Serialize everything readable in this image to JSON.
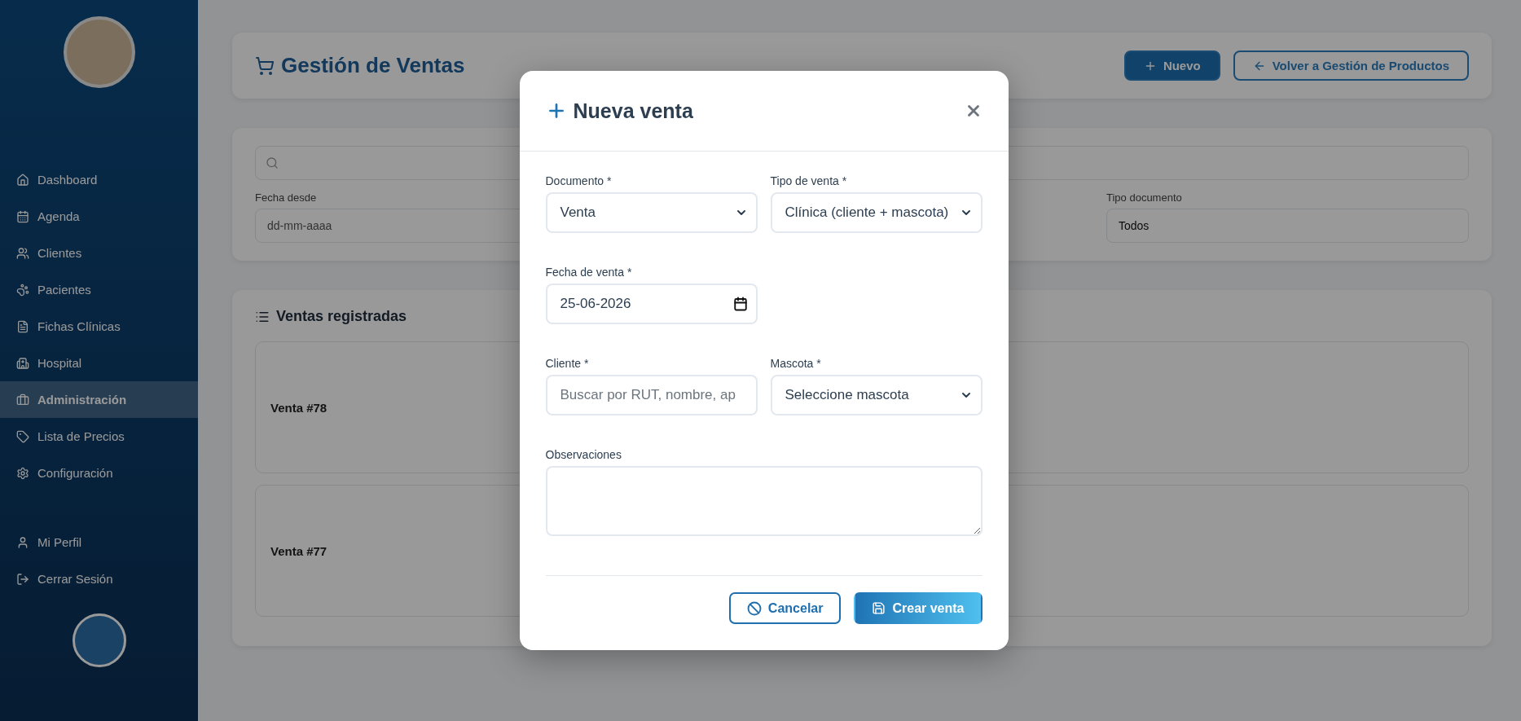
{
  "sidebar": {
    "items": [
      {
        "label": "Dashboard",
        "selected": false
      },
      {
        "label": "Agenda",
        "selected": false
      },
      {
        "label": "Clientes",
        "selected": false
      },
      {
        "label": "Pacientes",
        "selected": false
      },
      {
        "label": "Fichas Clínicas",
        "selected": false
      },
      {
        "label": "Hospital",
        "selected": false
      },
      {
        "label": "Administración",
        "selected": true
      },
      {
        "label": "Lista de Precios",
        "selected": false
      },
      {
        "label": "Configuración",
        "selected": false
      }
    ],
    "footer_items": [
      {
        "label": "Mi Perfil"
      },
      {
        "label": "Cerrar Sesión"
      }
    ]
  },
  "header": {
    "title": "Gestión de Ventas",
    "buttons": [
      {
        "label": "Nuevo",
        "kind": "primary"
      },
      {
        "label": "Volver a Gestión de Productos",
        "kind": "outline"
      }
    ]
  },
  "filters": {
    "fields": [
      {
        "label": "Fecha desde",
        "placeholder": "dd-mm-aaaa"
      },
      {
        "label": "Tipo documento",
        "value": "Todos"
      }
    ]
  },
  "sales": {
    "title": "Ventas registradas",
    "items": [
      {
        "title": "Venta #78"
      },
      {
        "title": "Venta #77"
      }
    ]
  },
  "dialog": {
    "title": "Nueva venta",
    "fields": [
      {
        "kind": "select",
        "label": "Documento *",
        "value": "Venta"
      },
      {
        "kind": "select",
        "label": "Tipo de venta *",
        "value": "Clínica (cliente + mascota)"
      },
      {
        "kind": "date",
        "label": "Fecha de venta *",
        "value": "25-06-2026"
      },
      {
        "kind": "text",
        "label": "Cliente *",
        "placeholder": "Buscar por RUT, nombre, ap"
      },
      {
        "kind": "select",
        "label": "Mascota *",
        "value": "Seleccione mascota"
      },
      {
        "kind": "textarea",
        "label": "Observaciones"
      }
    ],
    "buttons": [
      {
        "label": "Cancelar",
        "kind": "secondary"
      },
      {
        "label": "Crear venta",
        "kind": "primary"
      }
    ]
  }
}
